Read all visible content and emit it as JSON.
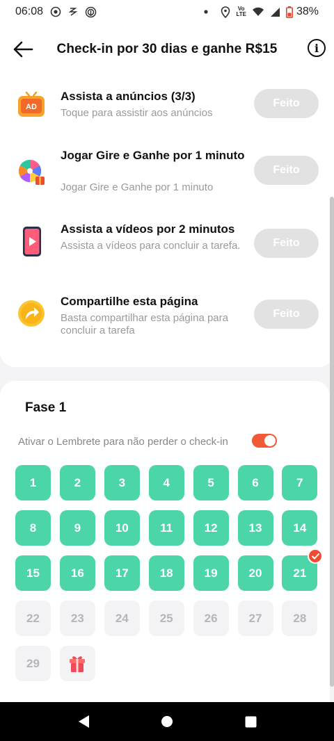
{
  "status_bar": {
    "time": "06:08",
    "network_label": "LTE",
    "battery": "38%",
    "icons": [
      "record-icon",
      "data-saver-icon",
      "nfc-icon",
      "dot-icon",
      "location-icon",
      "volte-icon",
      "wifi-icon",
      "signal-icon",
      "battery-icon"
    ]
  },
  "header": {
    "title": "Check-in por 30 dias e ganhe R$15",
    "back_icon": "back-arrow-icon",
    "info_icon": "info-icon",
    "info_glyph": "i"
  },
  "tasks": [
    {
      "icon": "ad-tv-icon",
      "icon_text": "AD",
      "title": "Assista a anúncios  (3/3)",
      "subtitle": "Toque para assistir aos anúncios",
      "button": "Feito"
    },
    {
      "icon": "spin-wheel-icon",
      "title": "Jogar Gire e Ganhe por 1 minuto",
      "subtitle": "Jogar Gire e Ganhe por 1 minuto",
      "button": "Feito"
    },
    {
      "icon": "video-phone-icon",
      "title": "Assista a vídeos por 2 minutos",
      "subtitle": "Assista a vídeos para concluir a tarefa.",
      "button": "Feito"
    },
    {
      "icon": "share-icon",
      "title": "Compartilhe esta página",
      "subtitle": "Basta compartilhar esta página para concluir a tarefa",
      "button": "Feito"
    }
  ],
  "phase": {
    "title": "Fase 1",
    "reminder_text": "Ativar o Lembrete para não perder o check-in",
    "reminder_enabled": true,
    "days_completed": 21,
    "last_checked_day": 21,
    "days": [
      "1",
      "2",
      "3",
      "4",
      "5",
      "6",
      "7",
      "8",
      "9",
      "10",
      "11",
      "12",
      "13",
      "14",
      "15",
      "16",
      "17",
      "18",
      "19",
      "20",
      "21",
      "22",
      "23",
      "24",
      "25",
      "26",
      "27",
      "28",
      "29"
    ],
    "final_reward_icon": "gift-icon"
  },
  "colors": {
    "done_day": "#4cd5a9",
    "toggle_on": "#f25a37",
    "check_badge": "#f14c32",
    "done_button": "#e2e2e2"
  },
  "nav": {
    "icons": [
      "back-triangle-icon",
      "home-circle-icon",
      "recents-square-icon"
    ]
  }
}
